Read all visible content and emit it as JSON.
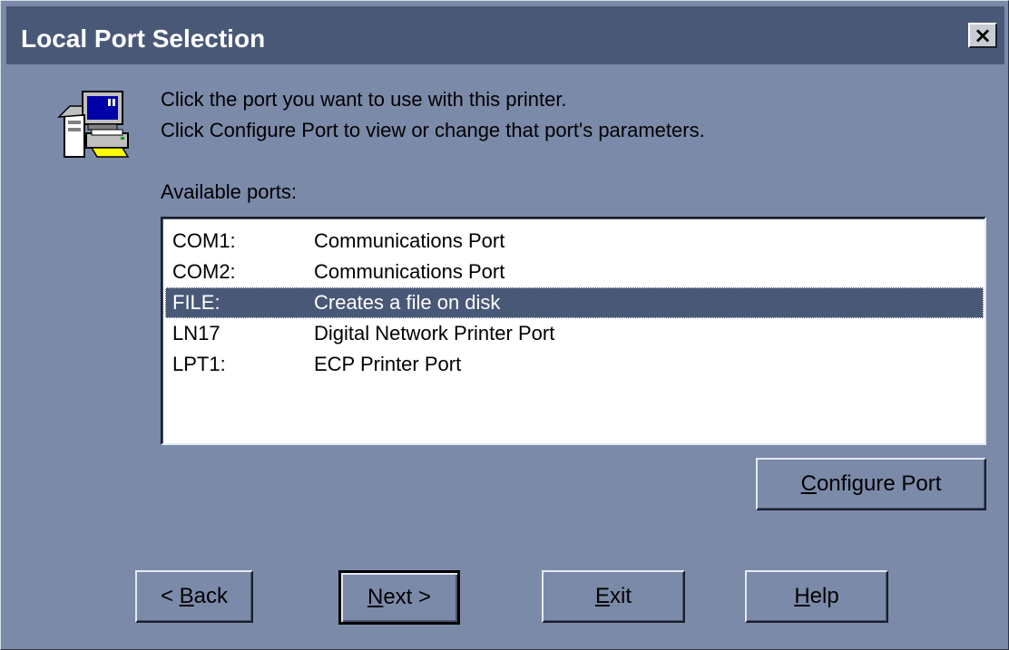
{
  "window": {
    "title": "Local Port Selection",
    "close_label": "×"
  },
  "instructions": {
    "line1": "Click the port you want to use with this printer.",
    "line2": "Click Configure Port to view or change that port's parameters."
  },
  "ports": {
    "label": "Available ports:",
    "items": [
      {
        "port": "COM1:",
        "description": "Communications Port",
        "selected": false
      },
      {
        "port": "COM2:",
        "description": "Communications Port",
        "selected": false
      },
      {
        "port": "FILE:",
        "description": "Creates a file on disk",
        "selected": true
      },
      {
        "port": "LN17",
        "description": "Digital Network Printer Port",
        "selected": false
      },
      {
        "port": "LPT1:",
        "description": "ECP Printer Port",
        "selected": false
      }
    ]
  },
  "buttons": {
    "configure": {
      "mnemonic": "C",
      "rest": "onfigure Port"
    },
    "back": {
      "prefix": "< ",
      "mnemonic": "B",
      "rest": "ack"
    },
    "next": {
      "mnemonic": "N",
      "rest": "ext >"
    },
    "exit": {
      "mnemonic": "E",
      "rest": "xit"
    },
    "help": {
      "mnemonic": "H",
      "rest": "elp"
    }
  },
  "icons": {
    "wizard": "printer-computer-icon",
    "close": "close-icon"
  },
  "colors": {
    "dialog_bg": "#7b8aa9",
    "titlebar_bg": "#4a5878",
    "selection_bg": "#4a5878",
    "list_bg": "#ffffff"
  }
}
